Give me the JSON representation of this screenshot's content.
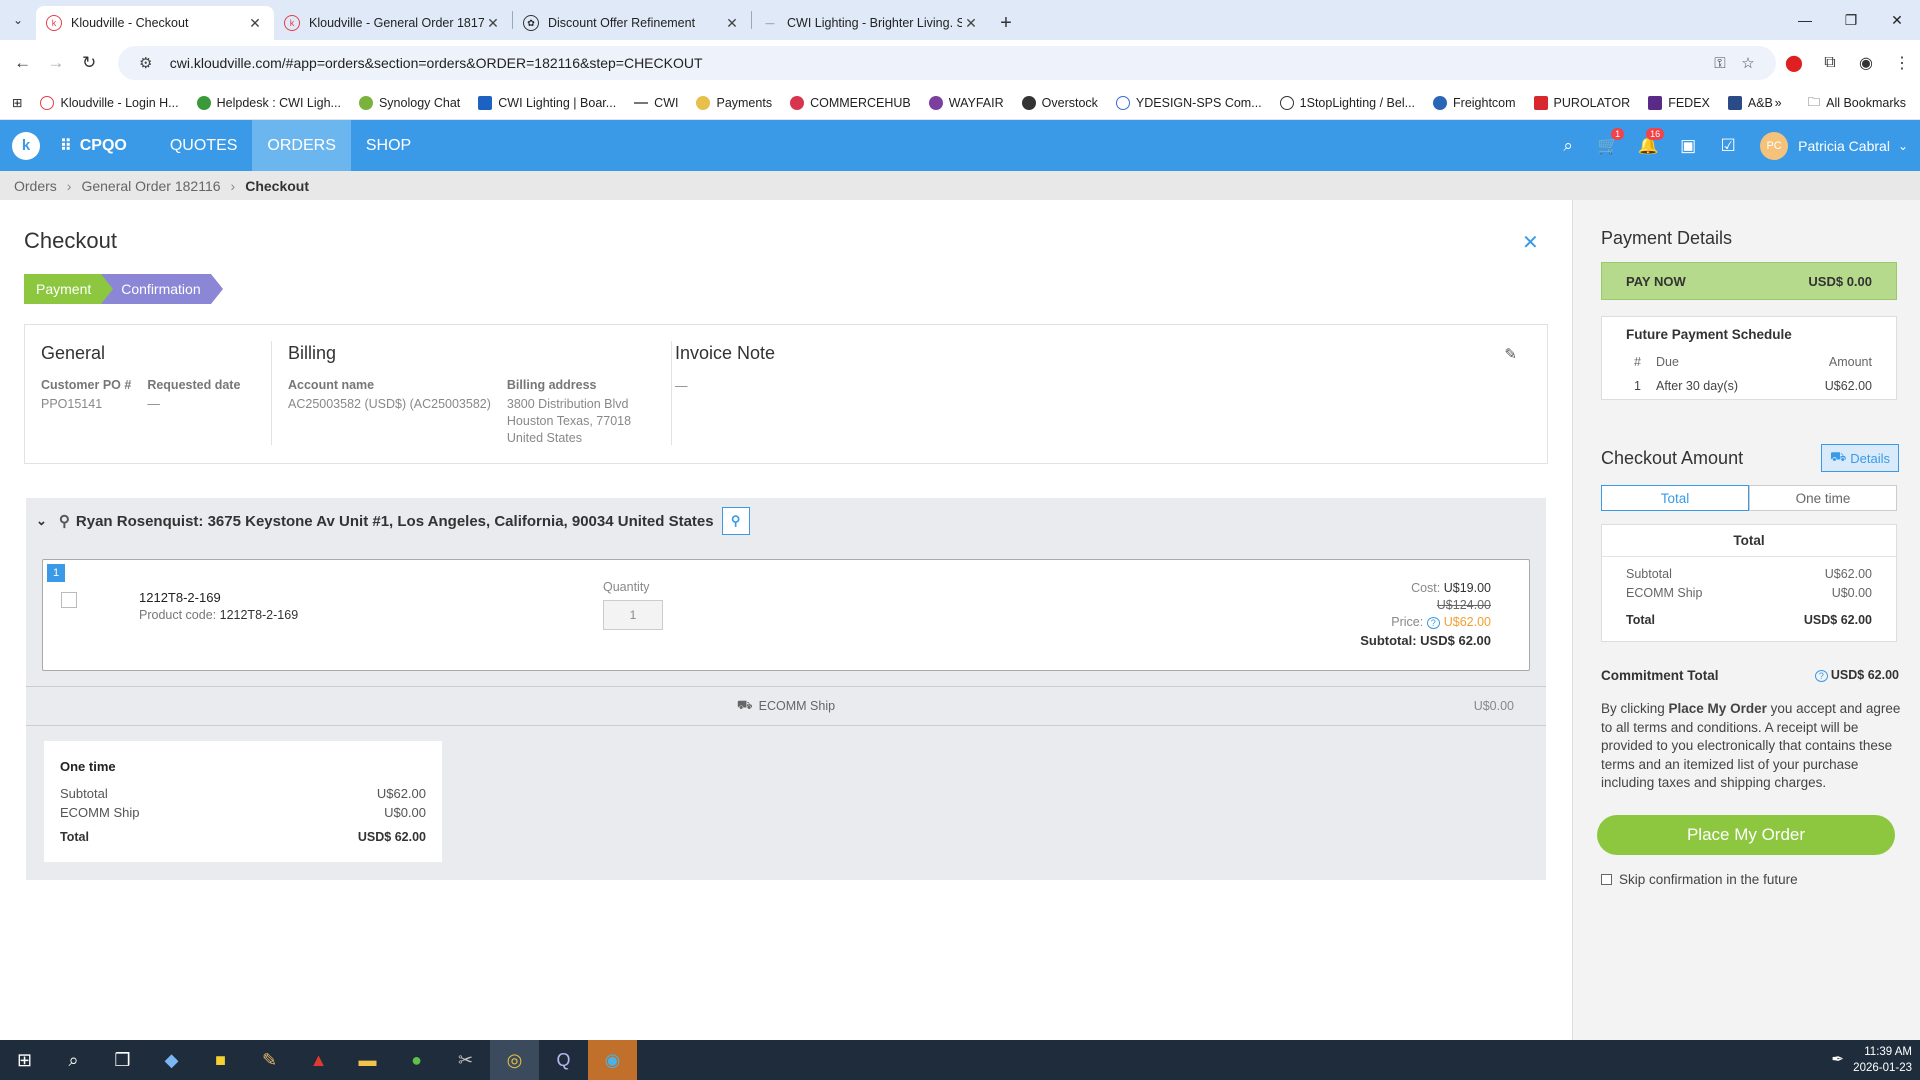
{
  "browser": {
    "tabs": [
      {
        "title": "Kloudville - Checkout",
        "active": true
      },
      {
        "title": "Kloudville - General Order 1817",
        "active": false
      },
      {
        "title": "Discount Offer Refinement",
        "active": false
      },
      {
        "title": "CWI Lighting - Brighter Living. S",
        "active": false
      }
    ],
    "url": "cwi.kloudville.com/#app=orders&section=orders&ORDER=182116&step=CHECKOUT",
    "bookmarks": [
      "Kloudville - Login H...",
      "Helpdesk : CWI Ligh...",
      "Synology Chat",
      "CWI Lighting | Boar...",
      "CWI",
      "Payments",
      "COMMERCEHUB",
      "WAYFAIR",
      "Overstock",
      "YDESIGN-SPS Com...",
      "1StopLighting / Bel...",
      "Freightcom",
      "PUROLATOR",
      "FEDEX",
      "A&B"
    ],
    "all_bookmarks": "All Bookmarks"
  },
  "appnav": {
    "brand": "CPQO",
    "items": [
      "QUOTES",
      "ORDERS",
      "SHOP"
    ],
    "active": "ORDERS",
    "cart_count": "1",
    "notif_count": "16",
    "avatar_initials": "PC",
    "user": "Patricia Cabral"
  },
  "breadcrumb": {
    "items": [
      "Orders",
      "General Order 182116"
    ],
    "current": "Checkout"
  },
  "checkout": {
    "title": "Checkout",
    "steps": [
      "Payment",
      "Confirmation"
    ],
    "general": {
      "heading": "General",
      "po_label": "Customer PO #",
      "po_value": "PPO15141",
      "req_label": "Requested date",
      "req_value": "—"
    },
    "billing": {
      "heading": "Billing",
      "acct_label": "Account name",
      "acct_value": "AC25003582 (USD$) (AC25003582)",
      "addr_label": "Billing address",
      "addr_line1": "3800 Distribution Blvd",
      "addr_line2": "Houston Texas, 77018",
      "addr_line3": "United States"
    },
    "invoice": {
      "heading": "Invoice Note",
      "value": "—"
    },
    "shipment": {
      "address": "Ryan Rosenquist: 3675 Keystone Av Unit #1, Los Angeles, California, 90034 United States",
      "line_number": "1",
      "product_name": "1212T8-2-169",
      "product_code_label": "Product code:",
      "product_code": "1212T8-2-169",
      "qty_label": "Quantity",
      "qty": "1",
      "cost_label": "Cost:",
      "cost": "U$19.00",
      "list_price": "U$124.00",
      "price_label": "Price:",
      "price": "U$62.00",
      "subtotal_label": "Subtotal:",
      "subtotal": "USD$ 62.00",
      "ship_method": "ECOMM Ship",
      "ship_amount": "U$0.00"
    },
    "onetime": {
      "heading": "One time",
      "subtotal_label": "Subtotal",
      "subtotal": "U$62.00",
      "ship_label": "ECOMM Ship",
      "ship": "U$0.00",
      "total_label": "Total",
      "total": "USD$ 62.00"
    }
  },
  "payment": {
    "title": "Payment Details",
    "pay_now_label": "PAY NOW",
    "pay_now_amount": "USD$  0.00",
    "schedule": {
      "heading": "Future Payment Schedule",
      "col_num": "#",
      "col_due": "Due",
      "col_amount": "Amount",
      "row_num": "1",
      "row_due": "After 30 day(s)",
      "row_amount": "U$62.00"
    },
    "checkout_amount_title": "Checkout Amount",
    "details_label": "Details",
    "seg_total": "Total",
    "seg_onetime": "One time",
    "totals": {
      "heading": "Total",
      "subtotal_label": "Subtotal",
      "subtotal": "U$62.00",
      "ship_label": "ECOMM Ship",
      "ship": "U$0.00",
      "total_label": "Total",
      "total": "USD$ 62.00"
    },
    "commitment_label": "Commitment Total",
    "commitment_value": "USD$ 62.00",
    "terms_pre": "By clicking ",
    "terms_bold": "Place My Order",
    "terms_post": " you accept and agree to all terms and conditions. A receipt will be provided to you electronically that contains these terms and an itemized list of your purchase including taxes and shipping charges.",
    "place_order": "Place My Order",
    "skip_label": "Skip confirmation in the future"
  },
  "taskbar": {
    "time": "11:39 AM",
    "date": "2026-01-23"
  },
  "colors": {
    "brand_blue": "#3a9ae8",
    "green": "#8cc73f",
    "purple": "#8b86d6"
  }
}
